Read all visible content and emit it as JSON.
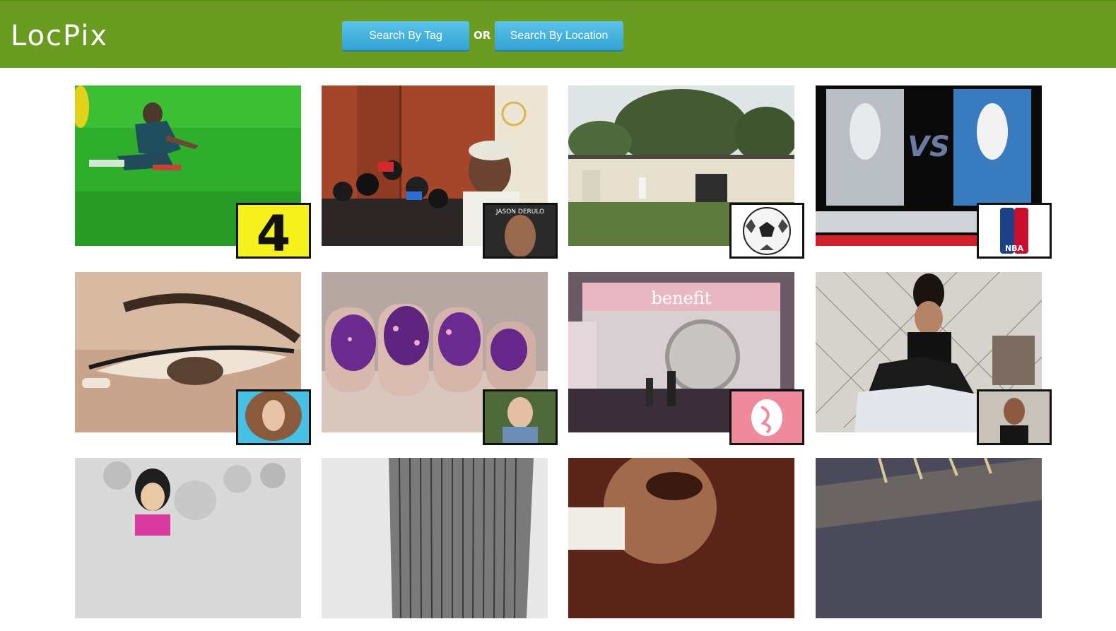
{
  "header": {
    "logo_text": "LocPix",
    "search_by_tag_label": "Search By Tag",
    "or_label": "OR",
    "search_by_location_label": "Search By Location",
    "background_color": "#6a9c22",
    "button_color": "#3aaedc"
  },
  "grid": {
    "tiles": [
      {
        "photo": "soccer-player-kneeling-on-grass",
        "badge": "number-4-logo",
        "badge_text": "4"
      },
      {
        "photo": "press-conference-microphones",
        "badge": "jason-derulo-album-cover",
        "badge_text": "JASON DERULO"
      },
      {
        "photo": "person-kicking-ball-in-yard",
        "badge": "soccer-ball"
      },
      {
        "photo": "spurs-vs-thunder-game-6-poster",
        "badge": "nba-logo",
        "badge_text": "NBA",
        "photo_text": "VS"
      },
      {
        "photo": "eyeliner-makeup-closeup",
        "badge": "woman-portrait"
      },
      {
        "photo": "purple-leopard-nail-art",
        "badge": "woman-portrait"
      },
      {
        "photo": "benefit-cosmetics-booth",
        "badge": "benefit-logo",
        "photo_text": "benefit"
      },
      {
        "photo": "woman-sitting-by-fence",
        "badge": "woman-portrait"
      },
      {
        "photo": "cartoon-characters-sketch"
      },
      {
        "photo": "skyscraper-black-and-white"
      },
      {
        "photo": "man-laughing-closeup"
      },
      {
        "photo": "road-asphalt-dusk"
      }
    ]
  }
}
